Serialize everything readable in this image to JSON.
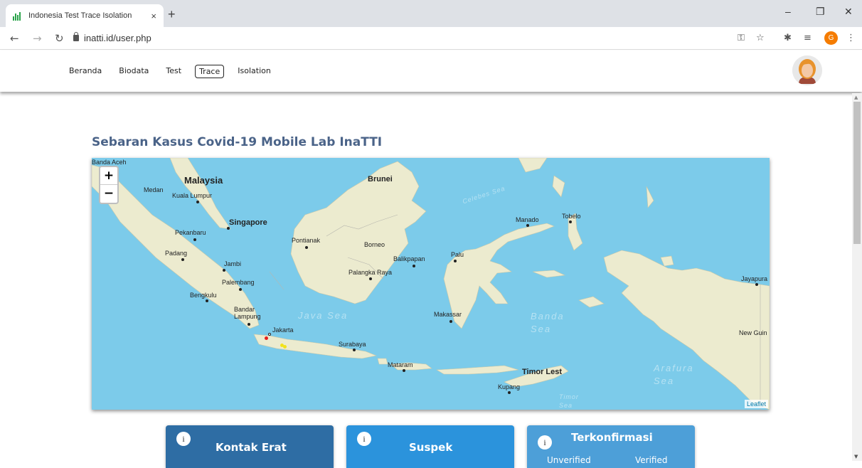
{
  "browser": {
    "tab_title": "Indonesia Test Trace Isolation",
    "tab_close": "×",
    "new_tab": "+",
    "url": "inatti.id/user.php",
    "profile_initial": "G",
    "minimize": "–",
    "restore": "❐",
    "close": "✕"
  },
  "nav": {
    "items": [
      {
        "label": "Beranda"
      },
      {
        "label": "Biodata"
      },
      {
        "label": "Test"
      },
      {
        "label": "Trace"
      },
      {
        "label": "Isolation"
      }
    ],
    "active": "Trace"
  },
  "page": {
    "heading": "Sebaran Kasus Covid-19 Mobile Lab InaTTI"
  },
  "map": {
    "zoom_in": "+",
    "zoom_out": "−",
    "attribution": "Leaflet",
    "labels": {
      "banda_aceh": "Banda Aceh",
      "malaysia": "Malaysia",
      "brunei": "Brunei",
      "medan": "Medan",
      "kuala_lumpur": "Kuala Lumpur",
      "singapore": "Singapore",
      "pekanbaru": "Pekanbaru",
      "padang": "Padang",
      "jambi": "Jambi",
      "palembang": "Palembang",
      "bengkulu": "Bengkulu",
      "bandar_lampung": "Bandar Lampung",
      "jakarta": "Jakarta",
      "pontianak": "Pontianak",
      "borneo": "Borneo",
      "balikpapan": "Balikpapan",
      "palangka_raya": "Palangka Raya",
      "surabaya": "Surabaya",
      "mataram": "Mataram",
      "makassar": "Makassar",
      "palu": "Palu",
      "manado": "Manado",
      "tobelo": "Tobelo",
      "jayapura": "Jayapura",
      "new_guinea": "New Guin",
      "timor_leste": "Timor Lest",
      "kupang": "Kupang",
      "java_sea": "Java Sea",
      "banda_sea": "Banda Sea",
      "arafura_sea": "Arafura Sea",
      "celebes_sea": "Celebes Sea",
      "timor_sea": "Timor Sea"
    },
    "marker_colors": {
      "red": "#e8201e",
      "yellow": "#f2e21b"
    }
  },
  "cards": [
    {
      "title": "Kontak Erat",
      "color": "#2e6da4"
    },
    {
      "title": "Suspek",
      "color": "#2b93dc"
    },
    {
      "title": "Terkonfirmasi",
      "color": "#4d9fd8",
      "sub_left": "Unverified",
      "sub_right": "Verified"
    }
  ],
  "info_glyph": "i"
}
